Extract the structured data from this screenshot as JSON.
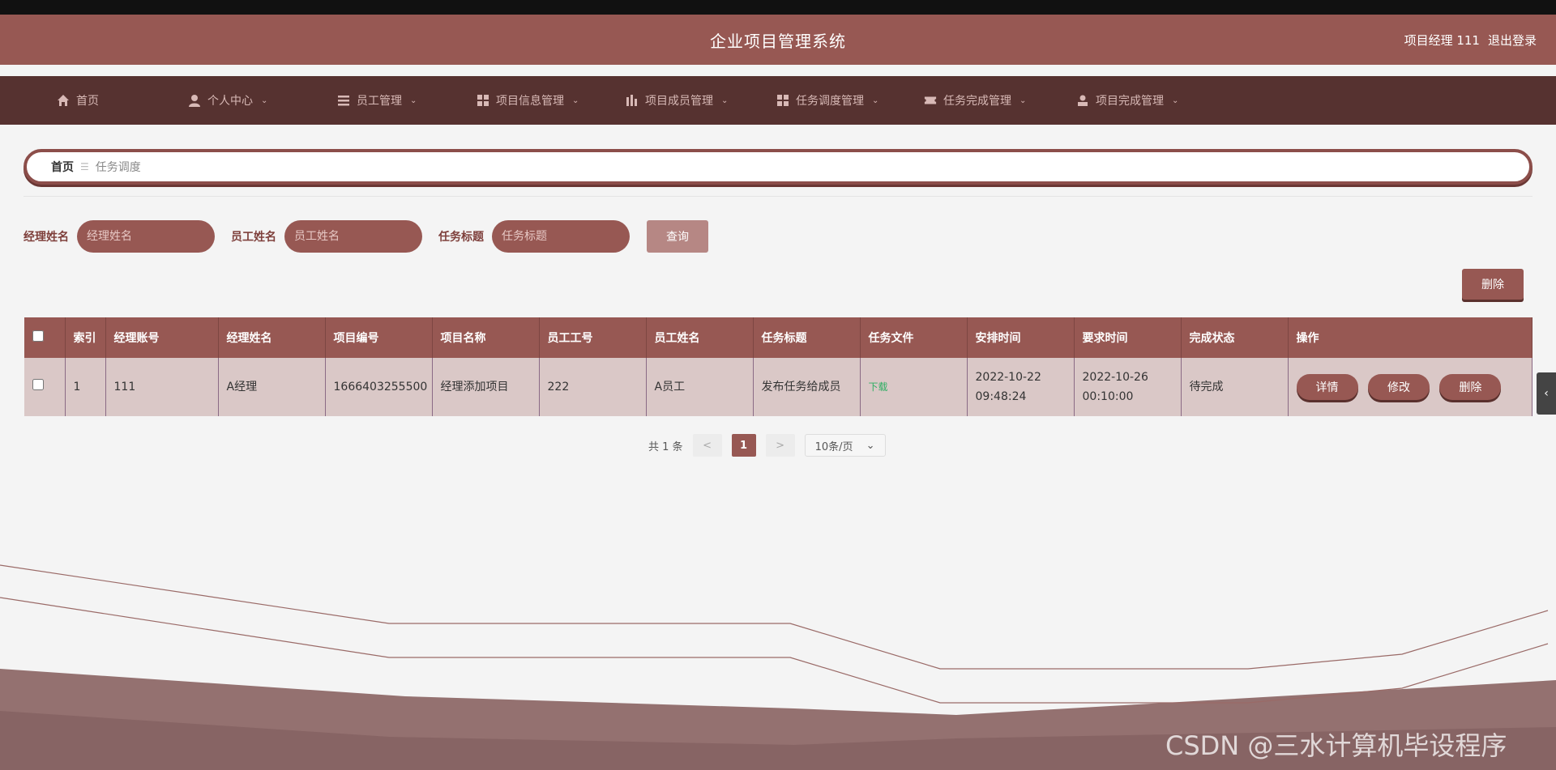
{
  "header": {
    "title": "企业项目管理系统",
    "user_role": "项目经理 111",
    "logout": "退出登录"
  },
  "nav": [
    {
      "label": "首页",
      "icon": "home-icon"
    },
    {
      "label": "个人中心",
      "icon": "user-icon"
    },
    {
      "label": "员工管理",
      "icon": "list-icon"
    },
    {
      "label": "项目信息管理",
      "icon": "grid-icon"
    },
    {
      "label": "项目成员管理",
      "icon": "chart-icon"
    },
    {
      "label": "任务调度管理",
      "icon": "grid-icon"
    },
    {
      "label": "任务完成管理",
      "icon": "ticket-icon"
    },
    {
      "label": "项目完成管理",
      "icon": "person-icon"
    }
  ],
  "breadcrumb": {
    "home": "首页",
    "current": "任务调度"
  },
  "search": {
    "manager_label": "经理姓名",
    "manager_placeholder": "经理姓名",
    "employee_label": "员工姓名",
    "employee_placeholder": "员工姓名",
    "task_label": "任务标题",
    "task_placeholder": "任务标题",
    "query_button": "查询"
  },
  "delete_button": "删除",
  "table": {
    "columns": [
      "索引",
      "经理账号",
      "经理姓名",
      "项目编号",
      "项目名称",
      "员工工号",
      "员工姓名",
      "任务标题",
      "任务文件",
      "安排时间",
      "要求时间",
      "完成状态",
      "操作"
    ],
    "rows": [
      {
        "index": "1",
        "manager_account": "111",
        "manager_name": "A经理",
        "project_no": "1666403255500",
        "project_name": "经理添加项目",
        "employee_no": "222",
        "employee_name": "A员工",
        "task_title": "发布任务给成员",
        "task_file": "下载",
        "scheduled": "2022-10-22 09:48:24",
        "required": "2022-10-26 00:10:00",
        "status": "待完成",
        "actions": {
          "detail": "详情",
          "edit": "修改",
          "delete": "删除"
        }
      }
    ]
  },
  "pager": {
    "total": "共 1 条",
    "prev": "<",
    "page": "1",
    "next": ">",
    "size": "10条/页"
  },
  "watermark": "CSDN @三水计算机毕设程序",
  "colors": {
    "primary": "#975853",
    "nav_bg": "#563230",
    "row_bg": "#dac8c7"
  }
}
